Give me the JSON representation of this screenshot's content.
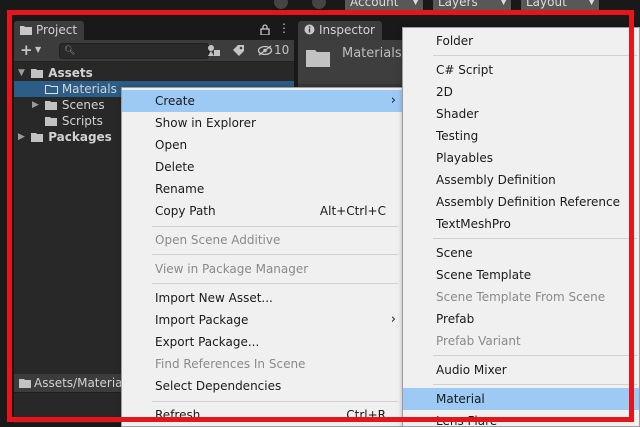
{
  "toolbar": {
    "account_label": "Account",
    "layers_label": "Layers",
    "layout_label": "Layout"
  },
  "project": {
    "tab_label": "Project",
    "visibility_count": "10",
    "tree": [
      {
        "label": "Assets",
        "bold": true
      },
      {
        "label": "Materials",
        "selected": true
      },
      {
        "label": "Scenes"
      },
      {
        "label": "Scripts"
      },
      {
        "label": "Packages",
        "bold": true
      }
    ],
    "path": "Assets/Materials"
  },
  "inspector": {
    "tab_label": "Inspector",
    "object_name": "Materials"
  },
  "context_menu": [
    {
      "label": "Create",
      "highlight": true,
      "submenu": true
    },
    {
      "label": "Show in Explorer"
    },
    {
      "label": "Open"
    },
    {
      "label": "Delete"
    },
    {
      "label": "Rename"
    },
    {
      "label": "Copy Path",
      "shortcut": "Alt+Ctrl+C"
    },
    {
      "label": "Open Scene Additive",
      "disabled": true
    },
    {
      "label": "View in Package Manager",
      "disabled": true
    },
    {
      "label": "Import New Asset..."
    },
    {
      "label": "Import Package",
      "submenu": true
    },
    {
      "label": "Export Package..."
    },
    {
      "label": "Find References In Scene",
      "disabled": true
    },
    {
      "label": "Select Dependencies"
    },
    {
      "label": "Refresh",
      "shortcut": "Ctrl+R"
    }
  ],
  "create_submenu": [
    {
      "label": "Folder"
    },
    {
      "label": "C# Script"
    },
    {
      "label": "2D"
    },
    {
      "label": "Shader"
    },
    {
      "label": "Testing"
    },
    {
      "label": "Playables"
    },
    {
      "label": "Assembly Definition"
    },
    {
      "label": "Assembly Definition Reference"
    },
    {
      "label": "TextMeshPro"
    },
    {
      "label": "Scene"
    },
    {
      "label": "Scene Template"
    },
    {
      "label": "Scene Template From Scene",
      "disabled": true
    },
    {
      "label": "Prefab"
    },
    {
      "label": "Prefab Variant",
      "disabled": true
    },
    {
      "label": "Audio Mixer"
    },
    {
      "label": "Material",
      "highlight": true
    },
    {
      "label": "Lens Flare"
    }
  ],
  "colors": {
    "highlight": "#9ccaf5",
    "selection": "#2c5d87",
    "frame": "#e8141b"
  }
}
